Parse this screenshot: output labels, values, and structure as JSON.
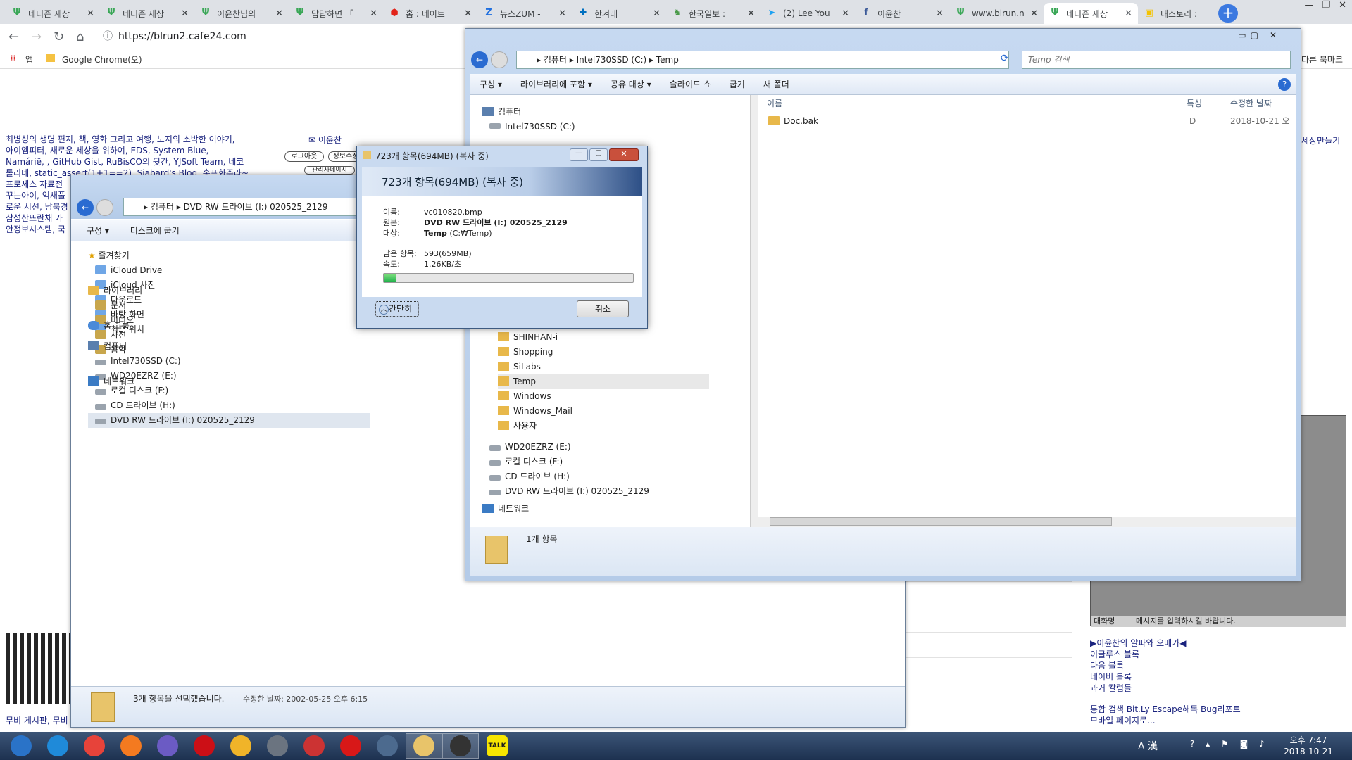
{
  "chrome": {
    "tabs": [
      "네티즌 세상",
      "네티즌 세상",
      "이윤찬님의",
      "답답하면 「",
      "홈 : 네이트",
      "뉴스ZUM -",
      "한겨레",
      "한국일보 :",
      "(2) Lee You",
      "이윤찬",
      "www.blrun.n",
      "네티즌 세상",
      "내스토리 : "
    ],
    "tab_icons": [
      "leaf-icon",
      "leaf-icon",
      "leaf-icon",
      "leaf-icon",
      "nate-icon",
      "zum-icon",
      "hani-icon",
      "hankook-icon",
      "twitter-icon",
      "facebook-icon",
      "leaf-icon",
      "leaf-icon",
      "kakao-story-icon"
    ],
    "active_tab_index": 11,
    "url": "https://blrun2.cafe24.com",
    "bookmarks": {
      "apps": "앱",
      "folder": "Google Chrome(오)",
      "right": "다른 북마크"
    }
  },
  "page": {
    "blog_lines": [
      "최병성의 생명 편지, 책, 영화 그리고 여행, 노지의 소박한 이야기,",
      "아이엠피터, 새로운 세상을 위하여, EDS, System Blue,",
      "Namárië, , GitHub Gist, RuBisCO의 뒷간, YJSoft Team, 네코",
      "롤리네, static_assert(1+1==2), Siabard's Blog, 홍프화주라~",
      "프로세스 자료전",
      "꾸는아이, 억새풀",
      "로운 시선, 남북경",
      "삼성산뜨란채 카",
      "안정보시스템, 국"
    ],
    "user_name": "이윤찬",
    "btn_logout": "로그아웃",
    "btn_info": "정보수정",
    "btn_admin": "관리자페이지",
    "right_link": "세상만들기",
    "side_links": [
      "▶이윤찬의 알파와 오메가◀",
      "이글루스 블록",
      "다음 블록",
      "네이버 블록",
      "과거 칼럼들"
    ],
    "search_line": "통합 검색 Bit.Ly Escape해독 Bug리포트",
    "mobile_line": "모바일 페이지로...",
    "chat_name": "대화명",
    "chat_msg": "메시지를 입력하시길 바랍니다.",
    "footer_left": "무비 게시판, 무비"
  },
  "left_explorer": {
    "path": [
      "컴퓨터",
      "DVD RW 드라이브 (I:) 020525_2129"
    ],
    "cmd": [
      "구성 ▾",
      "디스크에 굽기"
    ],
    "favorites_header": "즐겨찾기",
    "favorites": [
      "iCloud Drive",
      "iCloud 사진",
      "다운로드",
      "바탕 화면",
      "최근 위치"
    ],
    "libraries_header": "라이브러리",
    "libraries": [
      "문서",
      "비디오",
      "사진",
      "음악"
    ],
    "homegroup": "홈 그룹",
    "computer_header": "컴퓨터",
    "drives": [
      "Intel730SSD (C:)",
      "WD20EZRZ (E:)",
      "로컬 디스크 (F:)",
      "CD 드라이브 (H:)",
      "DVD RW 드라이브 (I:) 020525_2129"
    ],
    "network": "네트워크",
    "status": "3개 항목을 선택했습니다.",
    "status_date": "수정한 날짜: 2002-05-25 오후 6:15"
  },
  "right_explorer": {
    "path": [
      "컴퓨터",
      "Intel730SSD (C:)",
      "Temp"
    ],
    "search_placeholder": "Temp 검색",
    "cmd": [
      "구성 ▾",
      "라이브러리에 포함 ▾",
      "공유 대상 ▾",
      "슬라이드 쇼",
      "굽기",
      "새 폴더"
    ],
    "tree_computer": "컴퓨터",
    "tree_c": "Intel730SSD (C:)",
    "tree_folders": [
      "SHINHAN-i",
      "Shopping",
      "SiLabs",
      "Temp",
      "Windows",
      "Windows_Mail",
      "사용자"
    ],
    "tree_drives": [
      "WD20EZRZ (E:)",
      "로컬 디스크 (F:)",
      "CD 드라이브 (H:)",
      "DVD RW 드라이브 (I:) 020525_2129"
    ],
    "tree_network": "네트워크",
    "col_name": "이름",
    "col_attr": "특성",
    "col_date": "수정한 날짜",
    "file_name": "Doc.bak",
    "file_attr": "D",
    "file_date": "2018-10-21 오",
    "status": "1개 항목"
  },
  "copy_dialog": {
    "title": "723개 항목(694MB) (복사 중)",
    "heading": "723개 항목(694MB) (복사 중)",
    "name_label": "이름:",
    "name_value": "vc010820.bmp",
    "from_label": "원본:",
    "from_value": "DVD RW 드라이브 (I:) 020525_2129",
    "to_label": "대상:",
    "to_value": "Temp",
    "to_path": "(C:₩Temp)",
    "remain_label": "남은 항목:",
    "remain_value": "593(659MB)",
    "speed_label": "속도:",
    "speed_value": "1.26KB/초",
    "progress": 0.05,
    "less_details": "간단히",
    "cancel": "취소"
  },
  "taskbar": {
    "icons": [
      "start-orb-icon",
      "ie-icon",
      "chrome-icon",
      "firefox-icon",
      "stylus-icon",
      "opera-icon",
      "pen-icon",
      "chip-icon",
      "game-icon",
      "record-icon",
      "network-icon",
      "explorer-icon",
      "perf-icon",
      "kakaotalk-icon"
    ],
    "talk_label": "TALK",
    "ime": "A 漢",
    "time": "오후 7:47",
    "date": "2018-10-21"
  },
  "colors": {
    "chrome_bg": "#dee1e6",
    "taskbar": "#1d3150",
    "progress": "#22b14c",
    "explorer_border": "#6b7f98"
  }
}
